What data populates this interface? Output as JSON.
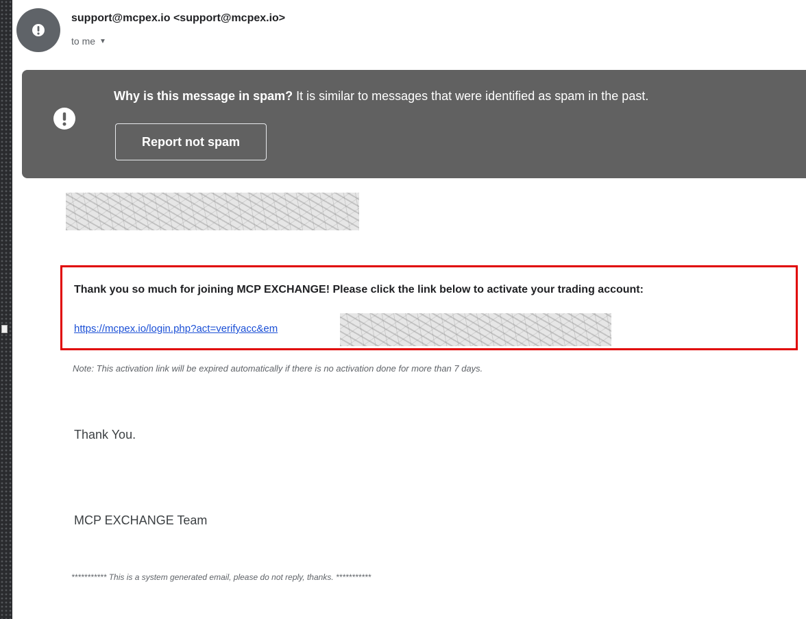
{
  "header": {
    "sender": "support@mcpex.io <support@mcpex.io>",
    "to": "to me",
    "avatar_icon": "exclamation-icon"
  },
  "spam_banner": {
    "question": "Why is this message in spam?",
    "explanation": " It is similar to messages that were identified as spam in the past.",
    "button_label": "Report not spam",
    "icon": "exclamation-icon"
  },
  "body": {
    "intro": "Thank you so much for joining MCP EXCHANGE! Please click the link below to activate your trading account:",
    "link_text": "https://mcpex.io/login.php?act=verifyacc&em",
    "note": "Note: This activation link will be expired automatically if there is no activation done for more than 7 days.",
    "thanks": "Thank You.",
    "signature": "MCP EXCHANGE Team",
    "footer": "*********** This is a system generated email, please do not reply, thanks. ***********"
  },
  "colors": {
    "spam_banner_bg": "#616161",
    "link": "#1a4fd6",
    "highlight_border": "#e00000"
  }
}
